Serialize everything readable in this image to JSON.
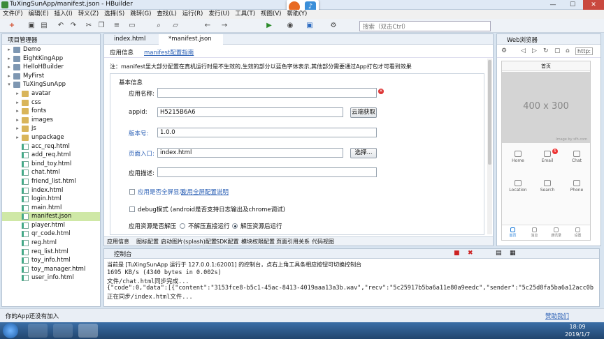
{
  "window": {
    "title": "TuXingSunApp/manifest.json - HBuilder",
    "minimize": "—",
    "maximize": "☐",
    "close": "✕"
  },
  "menu": [
    "文件(F)",
    "编辑(E)",
    "插入(I)",
    "转义(Z)",
    "选择(S)",
    "跳转(G)",
    "查找(L)",
    "运行(R)",
    "发行(U)",
    "工具(T)",
    "视图(V)",
    "帮助(Y)"
  ],
  "toolbar": {
    "search_placeholder": "搜索（双击Ctrl）"
  },
  "project_panel": {
    "title": "项目管理器",
    "tree": [
      {
        "label": "Demo",
        "type": "proj",
        "depth": 0,
        "arrow": "▸"
      },
      {
        "label": "EightKingApp",
        "type": "proj",
        "depth": 0,
        "arrow": "▸"
      },
      {
        "label": "HelloHBuilder",
        "type": "proj",
        "depth": 0,
        "arrow": "▸"
      },
      {
        "label": "MyFirst",
        "type": "proj",
        "depth": 0,
        "arrow": "▸"
      },
      {
        "label": "TuXingSunApp",
        "type": "proj",
        "depth": 0,
        "arrow": "▾"
      },
      {
        "label": "avatar",
        "type": "fold",
        "depth": 1,
        "arrow": "▸"
      },
      {
        "label": "css",
        "type": "fold",
        "depth": 1,
        "arrow": "▸"
      },
      {
        "label": "fonts",
        "type": "fold",
        "depth": 1,
        "arrow": "▸"
      },
      {
        "label": "images",
        "type": "fold",
        "depth": 1,
        "arrow": "▸"
      },
      {
        "label": "js",
        "type": "fold",
        "depth": 1,
        "arrow": "▸"
      },
      {
        "label": "unpackage",
        "type": "fold",
        "depth": 1,
        "arrow": "▸"
      },
      {
        "label": "acc_req.html",
        "type": "file",
        "depth": 1,
        "arrow": ""
      },
      {
        "label": "add_req.html",
        "type": "file",
        "depth": 1,
        "arrow": ""
      },
      {
        "label": "bind_toy.html",
        "type": "file",
        "depth": 1,
        "arrow": ""
      },
      {
        "label": "chat.html",
        "type": "file",
        "depth": 1,
        "arrow": ""
      },
      {
        "label": "friend_list.html",
        "type": "file",
        "depth": 1,
        "arrow": ""
      },
      {
        "label": "index.html",
        "type": "file",
        "depth": 1,
        "arrow": ""
      },
      {
        "label": "login.html",
        "type": "file",
        "depth": 1,
        "arrow": ""
      },
      {
        "label": "main.html",
        "type": "file",
        "depth": 1,
        "arrow": ""
      },
      {
        "label": "manifest.json",
        "type": "file",
        "depth": 1,
        "arrow": "",
        "selected": true
      },
      {
        "label": "player.html",
        "type": "file",
        "depth": 1,
        "arrow": ""
      },
      {
        "label": "qr_code.html",
        "type": "file",
        "depth": 1,
        "arrow": ""
      },
      {
        "label": "reg.html",
        "type": "file",
        "depth": 1,
        "arrow": ""
      },
      {
        "label": "req_list.html",
        "type": "file",
        "depth": 1,
        "arrow": ""
      },
      {
        "label": "toy_info.html",
        "type": "file",
        "depth": 1,
        "arrow": ""
      },
      {
        "label": "toy_manager.html",
        "type": "file",
        "depth": 1,
        "arrow": ""
      },
      {
        "label": "user_info.html",
        "type": "file",
        "depth": 1,
        "arrow": ""
      }
    ]
  },
  "editor": {
    "tabs": [
      "index.html",
      "*manifest.json"
    ],
    "subtab_app_info": "应用信息",
    "subtab_guide": "manifest配置指南",
    "note": "注：manifest里大部分配置在真机运行时是不生效的,生效的部分以蓝色字体表示,其他部分需要通过App打包才可看到效果",
    "section_title": "基本信息",
    "fields": {
      "app_name_label": "应用名称:",
      "app_name_value": "",
      "appid_label": "appid:",
      "appid_value": "H5215B6A6",
      "appid_button": "云端获取",
      "version_label": "版本号:",
      "version_value": "1.0.0",
      "entry_label": "页面入口:",
      "entry_value": "index.html",
      "entry_button": "选择...",
      "desc_label": "应用描述:",
      "desc_value": "",
      "fullscreen_label": "应用是否全屏显示",
      "fullscreen_link": "应用全屏配置说明",
      "debug_label": "debug模式 (android是否支持日志输出及chrome调试)",
      "unpack_label": "应用资源是否解压",
      "unpack_opt1": "不解压直接运行",
      "unpack_opt2": "解压资源后运行"
    },
    "bottom_tabs": [
      "应用信息",
      "图标配置",
      "启动图片(splash)配置",
      "SDK配置",
      "模块权限配置",
      "页面引用关系",
      "代码视图"
    ]
  },
  "console": {
    "title": "控制台",
    "status": "当前是 [TuXingSunApp 运行于 127.0.0.1:62001] 的控制台，点右上角工具条相应按钮可切换控制台",
    "lines": [
      "1695 KB/s (4340 bytes in 0.002s)",
      "文件/chat.html同步完成...",
      "{\"code\":0,\"data\":[{\"content\":\"3153fce8-b5c1-45ac-8413-4019aaa13a3b.wav\",\"recv\":\"5c25917b5ba6a11e80a9eedc\",\"sender\":\"5c25d8fa5ba6a12acc0b",
      "正在同步/index.html文件..."
    ]
  },
  "browser": {
    "title": "Web浏览器",
    "url_prefix": "http:",
    "phone_title": "首页",
    "placeholder_img": "400 x 300",
    "img_caption": "Image by sfh.com",
    "grid": [
      "Home",
      "Email",
      "Chat",
      "Location",
      "Search",
      "Phone"
    ],
    "email_badge": "5",
    "nav": [
      "首页",
      "消息",
      "通讯录",
      "设置"
    ]
  },
  "statusbar": {
    "left": "你的App还没有加入",
    "right": "赞助我们"
  },
  "clock": {
    "time": "18:09",
    "date": "2019/1/7"
  }
}
